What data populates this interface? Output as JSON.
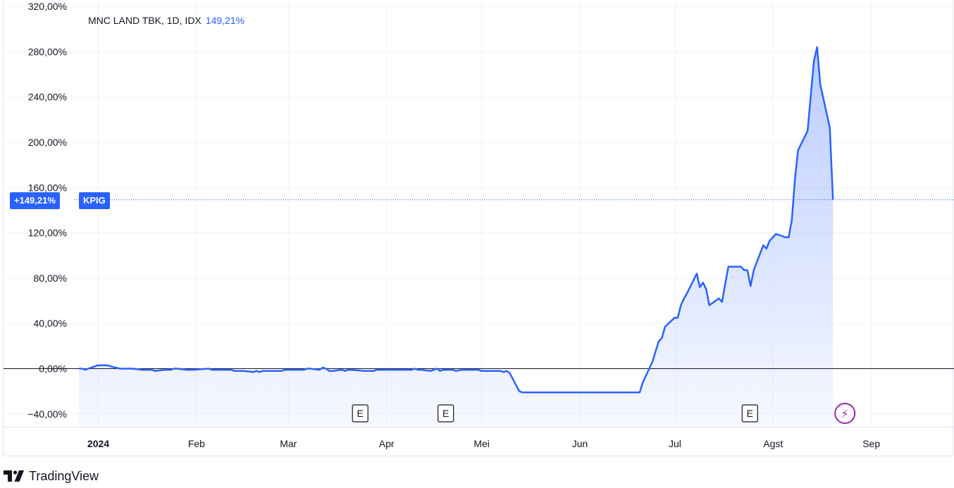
{
  "legend": {
    "symbol_line": "MNC LAND TBK, 1D, IDX",
    "value": "149,21%"
  },
  "badges": {
    "percent": "+149,21%",
    "ticker": "KPIG"
  },
  "footer": {
    "brand": "TradingView",
    "icon": "tradingview-logo-icon"
  },
  "colors": {
    "line": "#2962ff",
    "fill": "#2962ff",
    "zero_line": "#131722",
    "grid": "#f0f3fa",
    "badge": "#2962ff",
    "event_marker": "#9c27b0"
  },
  "chart_data": {
    "type": "area",
    "title": "MNC LAND TBK, 1D, IDX",
    "xlabel": "",
    "ylabel": "",
    "ylim": [
      -40,
      320
    ],
    "y_ticks": [
      "320,00%",
      "280,00%",
      "240,00%",
      "200,00%",
      "160,00%",
      "120,00%",
      "80,00%",
      "40,00%",
      "0,00%",
      "−40,00%"
    ],
    "x_ticks": [
      "2024",
      "Feb",
      "Mar",
      "Apr",
      "Mei",
      "Jun",
      "Jul",
      "Agst",
      "Sep"
    ],
    "last_value": 149.21,
    "grid": true,
    "series": [
      {
        "name": "KPIG",
        "points": [
          [
            "2024-01-02",
            0
          ],
          [
            "2024-01-03",
            0
          ],
          [
            "2024-01-04",
            -1
          ],
          [
            "2024-01-05",
            0
          ],
          [
            "2024-01-08",
            3
          ],
          [
            "2024-01-09",
            3
          ],
          [
            "2024-01-10",
            3
          ],
          [
            "2024-01-11",
            3
          ],
          [
            "2024-01-12",
            2
          ],
          [
            "2024-01-15",
            0
          ],
          [
            "2024-01-16",
            0
          ],
          [
            "2024-01-17",
            0
          ],
          [
            "2024-01-18",
            0
          ],
          [
            "2024-01-19",
            0
          ],
          [
            "2024-01-22",
            -1
          ],
          [
            "2024-01-23",
            -1
          ],
          [
            "2024-01-24",
            -1
          ],
          [
            "2024-01-25",
            -1
          ],
          [
            "2024-01-26",
            -2
          ],
          [
            "2024-01-29",
            -1
          ],
          [
            "2024-01-30",
            -1
          ],
          [
            "2024-01-31",
            -1
          ],
          [
            "2024-02-01",
            0
          ],
          [
            "2024-02-02",
            0
          ],
          [
            "2024-02-05",
            -1
          ],
          [
            "2024-02-06",
            -1
          ],
          [
            "2024-02-07",
            -1
          ],
          [
            "2024-02-12",
            0
          ],
          [
            "2024-02-13",
            -1
          ],
          [
            "2024-02-15",
            -1
          ],
          [
            "2024-02-16",
            -1
          ],
          [
            "2024-02-19",
            -1
          ],
          [
            "2024-02-20",
            -2
          ],
          [
            "2024-02-21",
            -2
          ],
          [
            "2024-02-22",
            -2
          ],
          [
            "2024-02-23",
            -2
          ],
          [
            "2024-02-26",
            -3
          ],
          [
            "2024-02-27",
            -2
          ],
          [
            "2024-02-28",
            -3
          ],
          [
            "2024-02-29",
            -2
          ],
          [
            "2024-03-01",
            -2
          ],
          [
            "2024-03-04",
            -2
          ],
          [
            "2024-03-05",
            -2
          ],
          [
            "2024-03-06",
            -2
          ],
          [
            "2024-03-07",
            -1
          ],
          [
            "2024-03-08",
            -1
          ],
          [
            "2024-03-13",
            -1
          ],
          [
            "2024-03-14",
            0
          ],
          [
            "2024-03-15",
            0
          ],
          [
            "2024-03-18",
            -1
          ],
          [
            "2024-03-19",
            1
          ],
          [
            "2024-03-20",
            0
          ],
          [
            "2024-03-21",
            -2
          ],
          [
            "2024-03-22",
            -2
          ],
          [
            "2024-03-25",
            -1
          ],
          [
            "2024-03-26",
            -2
          ],
          [
            "2024-03-27",
            -1
          ],
          [
            "2024-03-28",
            -1
          ],
          [
            "2024-04-01",
            -2
          ],
          [
            "2024-04-02",
            -2
          ],
          [
            "2024-04-03",
            -2
          ],
          [
            "2024-04-04",
            -2
          ],
          [
            "2024-04-05",
            -1
          ],
          [
            "2024-04-16",
            -1
          ],
          [
            "2024-04-17",
            0
          ],
          [
            "2024-04-18",
            -1
          ],
          [
            "2024-04-19",
            -1
          ],
          [
            "2024-04-22",
            -2
          ],
          [
            "2024-04-23",
            -1
          ],
          [
            "2024-04-24",
            0
          ],
          [
            "2024-04-25",
            -2
          ],
          [
            "2024-04-26",
            -1
          ],
          [
            "2024-04-29",
            -1
          ],
          [
            "2024-04-30",
            -2
          ],
          [
            "2024-05-02",
            -1
          ],
          [
            "2024-05-03",
            -1
          ],
          [
            "2024-05-06",
            -1
          ],
          [
            "2024-05-07",
            -1
          ],
          [
            "2024-05-08",
            -2
          ],
          [
            "2024-05-10",
            -2
          ],
          [
            "2024-05-13",
            -2
          ],
          [
            "2024-05-14",
            -2
          ],
          [
            "2024-05-15",
            -3
          ],
          [
            "2024-05-16",
            -2
          ],
          [
            "2024-05-17",
            -4
          ],
          [
            "2024-05-20",
            -20
          ],
          [
            "2024-05-21",
            -21
          ],
          [
            "2024-05-22",
            -21
          ],
          [
            "2024-05-27",
            -21
          ],
          [
            "2024-05-28",
            -21
          ],
          [
            "2024-06-03",
            -21
          ],
          [
            "2024-06-10",
            -21
          ],
          [
            "2024-06-14",
            -21
          ],
          [
            "2024-06-20",
            -21
          ],
          [
            "2024-06-26",
            -21
          ],
          [
            "2024-06-27",
            -21
          ],
          [
            "2024-06-28",
            -12
          ],
          [
            "2024-07-01",
            6
          ],
          [
            "2024-07-02",
            15
          ],
          [
            "2024-07-03",
            24
          ],
          [
            "2024-07-04",
            27
          ],
          [
            "2024-07-05",
            37
          ],
          [
            "2024-07-08",
            45
          ],
          [
            "2024-07-09",
            45
          ],
          [
            "2024-07-10",
            56
          ],
          [
            "2024-07-11",
            62
          ],
          [
            "2024-07-12",
            67
          ],
          [
            "2024-07-15",
            84
          ],
          [
            "2024-07-16",
            72
          ],
          [
            "2024-07-17",
            76
          ],
          [
            "2024-07-18",
            70
          ],
          [
            "2024-07-19",
            56
          ],
          [
            "2024-07-22",
            62
          ],
          [
            "2024-07-23",
            59
          ],
          [
            "2024-07-24",
            75
          ],
          [
            "2024-07-25",
            90
          ],
          [
            "2024-07-26",
            90
          ],
          [
            "2024-07-29",
            90
          ],
          [
            "2024-07-30",
            87
          ],
          [
            "2024-07-31",
            87
          ],
          [
            "2024-08-01",
            73
          ],
          [
            "2024-08-02",
            87
          ],
          [
            "2024-08-05",
            109
          ],
          [
            "2024-08-06",
            106
          ],
          [
            "2024-08-07",
            113
          ],
          [
            "2024-08-08",
            116
          ],
          [
            "2024-08-09",
            119
          ],
          [
            "2024-08-12",
            116
          ],
          [
            "2024-08-13",
            116
          ],
          [
            "2024-08-14",
            131
          ],
          [
            "2024-08-15",
            168
          ],
          [
            "2024-08-16",
            193
          ],
          [
            "2024-08-19",
            210
          ],
          [
            "2024-08-20",
            241
          ],
          [
            "2024-08-21",
            272
          ],
          [
            "2024-08-22",
            284
          ],
          [
            "2024-08-23",
            251
          ],
          [
            "2024-08-26",
            213
          ],
          [
            "2024-08-27",
            149.21
          ]
        ]
      }
    ],
    "event_markers": [
      {
        "label": "E",
        "date": "2024-03-29"
      },
      {
        "label": "E",
        "date": "2024-04-25"
      },
      {
        "label": "E",
        "date": "2024-07-30"
      },
      {
        "label": "⚡",
        "date": "2024-08-29"
      }
    ]
  }
}
